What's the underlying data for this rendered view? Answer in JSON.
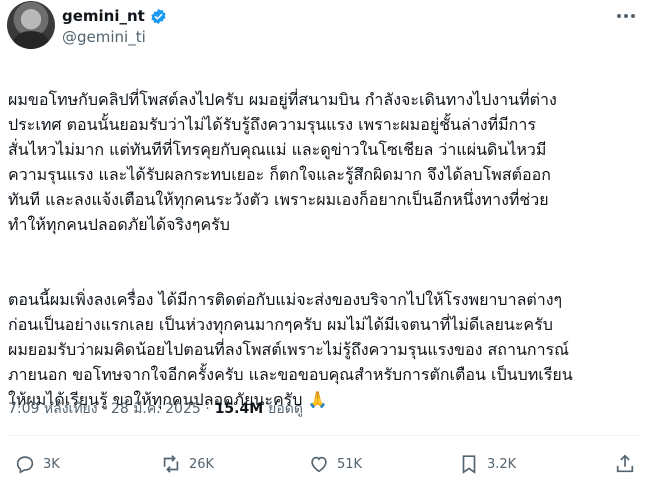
{
  "author": {
    "display_name": "gemini_nt",
    "handle": "@gemini_ti"
  },
  "tweet": {
    "paragraph1": "ผมขอโทษกับคลิปที่โพสต์ลงไปครับ ผมอยู่ที่สนามบิน กำลังจะเดินทางไปงานที่ต่าง\nประเทศ ตอนนั้นยอมรับว่าไม่ได้รับรู้ถึงความรุนแรง เพราะผมอยู่ชั้นล่างที่มีการ\nสั่นไหวไม่มาก  แต่ทันทีที่โทรคุยกับคุณแม่ และดูข่าวในโซเชียล ว่าแผ่นดินไหวมี\nความรุนแรง และได้รับผลกระทบเยอะ ก็ตกใจและรู้สึกผิดมาก จึงได้ลบโพสต์ออก\nทันที และลงแจ้งเตือนให้ทุกคนระวังตัว เพราะผมเองก็อยากเป็นอีกหนึ่งทางที่ช่วย\nทำให้ทุกคนปลอดภัยได้จริงๆครับ",
    "paragraph2": "ตอนนี้ผมเพิ่งลงเครื่อง ได้มีการติดต่อกับแม่จะส่งของบริจากไปให้โรงพยาบาลต่างๆ\nก่อนเป็นอย่างแรกเลย เป็นห่วงทุกคนมากๆครับ ผมไม่ได้มีเจตนาที่ไม่ดีเลยนะครับ\nผมยอมรับว่าผมคิดน้อยไปตอนที่ลงโพสต์เพราะไม่รู้ถึงความรุนแรงของ สถานการณ์\nภายนอก ขอโทษจากใจอีกครั้งครับ และขอขอบคุณสำหรับการตักเตือน เป็นบทเรียน\nให้ผมได้เรียนรู้ ขอให้ทุกคนปลอดภัยนะครับ 🙏",
    "time": "7:09 หลังเที่ยง · 28 มี.ค. 2025 ·",
    "views_count": "15.4M",
    "views_label": "ยอดดู"
  },
  "actions": {
    "replies": "3K",
    "reposts": "26K",
    "likes": "51K",
    "bookmarks": "3.2K"
  },
  "colors": {
    "verified": "#1d9bf0",
    "muted": "#536471",
    "text": "#0f1419"
  }
}
